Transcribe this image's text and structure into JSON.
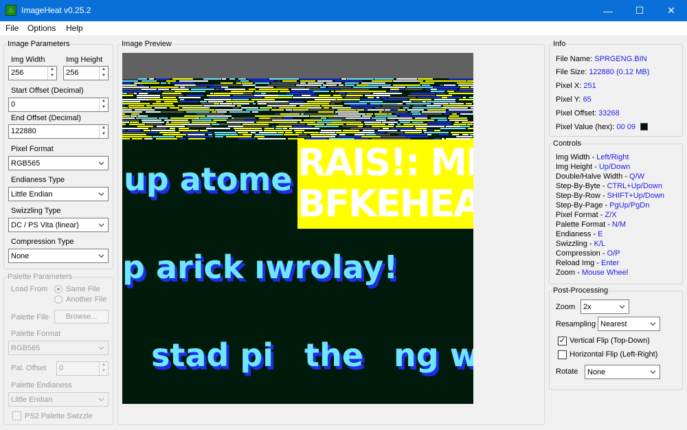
{
  "window": {
    "title": "ImageHeat v0.25.2",
    "minimize_glyph": "—",
    "maximize_glyph": "☐",
    "close_glyph": "✕"
  },
  "menu": [
    "File",
    "Options",
    "Help"
  ],
  "image_params": {
    "legend": "Image Parameters",
    "width_label": "Img Width",
    "width_value": "256",
    "height_label": "Img Height",
    "height_value": "256",
    "start_offset_label": "Start Offset (Decimal)",
    "start_offset_value": "0",
    "end_offset_label": "End Offset (Decimal)",
    "end_offset_value": "122880",
    "pixel_format_label": "Pixel Format",
    "pixel_format_value": "RGB565",
    "endianess_label": "Endianess Type",
    "endianess_value": "Little Endian",
    "swizzling_label": "Swizzling Type",
    "swizzling_value": "DC / PS Vita (linear)",
    "compression_label": "Compression Type",
    "compression_value": "None"
  },
  "palette_params": {
    "legend": "Palette Parameters",
    "load_from_label": "Load From",
    "same_file": "Same File",
    "another_file": "Another File",
    "palette_file_label": "Palette File",
    "browse_label": "Browse...",
    "palette_format_label": "Palette Format",
    "palette_format_value": "RGB565",
    "offset_label": "Pal. Offset",
    "offset_value": "0",
    "endianess_label": "Palette Endianess",
    "endianess_value": "Little Endian",
    "ps2_swizzle_label": "PS2 Palette Swizzle"
  },
  "preview": {
    "legend": "Image Preview",
    "text_lines": [
      "up atome",
      "p arick ıwrolay!",
      "stad pi",
      "the",
      "ng w"
    ],
    "yellow_lines": [
      "RAIS!: MRK.",
      "BFKEHEAR"
    ],
    "colors": {
      "background": "#001a0b",
      "text": "#6fe6ff",
      "shadow": "#1b2fe0",
      "yellow": "#ffff00",
      "top": "#616161"
    }
  },
  "info": {
    "legend": "Info",
    "file_name_label": "File Name:",
    "file_name": "SPRGENG.BIN",
    "file_size_label": "File Size:",
    "file_size": "122880 (0.12 MB)",
    "pixel_x_label": "Pixel X:",
    "pixel_x": "251",
    "pixel_y_label": "Pixel Y:",
    "pixel_y": "65",
    "pixel_offset_label": "Pixel Offset:",
    "pixel_offset": "33268",
    "pixel_value_label": "Pixel Value (hex):",
    "pixel_value": "00 09",
    "pixel_color": "#001208"
  },
  "controls": {
    "legend": "Controls",
    "items": [
      {
        "label": "Img Width - ",
        "keys": "Left/Right"
      },
      {
        "label": "Img Height - ",
        "keys": "Up/Down"
      },
      {
        "label": "Double/Halve Width - ",
        "keys": "Q/W"
      },
      {
        "label": "Step-By-Byte - ",
        "keys": "CTRL+Up/Down"
      },
      {
        "label": "Step-By-Row - ",
        "keys": "SHIFT+Up/Down"
      },
      {
        "label": "Step-By-Page - ",
        "keys": "PgUp/PgDn"
      },
      {
        "label": "Pixel Format - ",
        "keys": "Z/X"
      },
      {
        "label": "Palette Format - ",
        "keys": "N/M"
      },
      {
        "label": "Endianess - ",
        "keys": "E"
      },
      {
        "label": "Swizzling - ",
        "keys": "K/L"
      },
      {
        "label": "Compression - ",
        "keys": "O/P"
      },
      {
        "label": "Reload Img - ",
        "keys": "Enter"
      },
      {
        "label": "Zoom - ",
        "keys": "Mouse Wheel"
      }
    ]
  },
  "post": {
    "legend": "Post-Processing",
    "zoom_label": "Zoom",
    "zoom_value": "2x",
    "resampling_label": "Resampling",
    "resampling_value": "Nearest",
    "vflip_label": "Vertical Flip (Top-Down)",
    "vflip_checked": true,
    "hflip_label": "Horizontal Flip (Left-Right)",
    "hflip_checked": false,
    "rotate_label": "Rotate",
    "rotate_value": "None"
  }
}
